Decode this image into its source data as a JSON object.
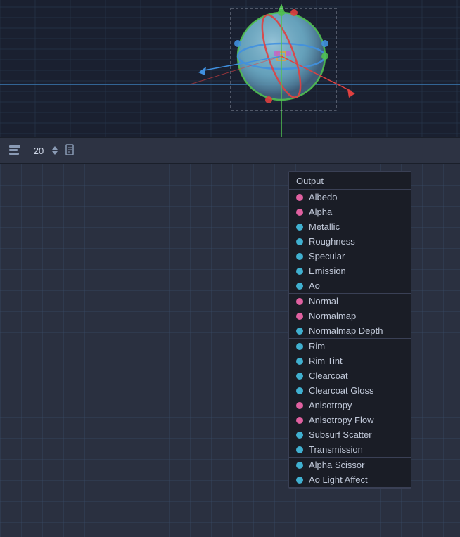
{
  "toolbar": {
    "number": "20",
    "doc_icon": "📄"
  },
  "dropdown": {
    "header": "Output",
    "sections": [
      {
        "items": [
          {
            "label": "Albedo",
            "dot": "pink",
            "id": "albedo"
          },
          {
            "label": "Alpha",
            "dot": "pink",
            "id": "alpha"
          },
          {
            "label": "Metallic",
            "dot": "cyan",
            "id": "metallic"
          },
          {
            "label": "Roughness",
            "dot": "cyan",
            "id": "roughness"
          },
          {
            "label": "Specular",
            "dot": "cyan",
            "id": "specular"
          },
          {
            "label": "Emission",
            "dot": "cyan",
            "id": "emission"
          },
          {
            "label": "Ao",
            "dot": "cyan",
            "id": "ao"
          }
        ]
      },
      {
        "items": [
          {
            "label": "Normal",
            "dot": "pink",
            "id": "normal"
          },
          {
            "label": "Normalmap",
            "dot": "pink",
            "id": "normalmap"
          },
          {
            "label": "Normalmap Depth",
            "dot": "cyan",
            "id": "normalmap-depth"
          }
        ]
      },
      {
        "items": [
          {
            "label": "Rim",
            "dot": "cyan",
            "id": "rim"
          },
          {
            "label": "Rim Tint",
            "dot": "cyan",
            "id": "rim-tint"
          },
          {
            "label": "Clearcoat",
            "dot": "cyan",
            "id": "clearcoat"
          },
          {
            "label": "Clearcoat Gloss",
            "dot": "cyan",
            "id": "clearcoat-gloss"
          },
          {
            "label": "Anisotropy",
            "dot": "pink",
            "id": "anisotropy"
          },
          {
            "label": "Anisotropy Flow",
            "dot": "pink",
            "id": "anisotropy-flow"
          },
          {
            "label": "Subsurf Scatter",
            "dot": "cyan",
            "id": "subsurf-scatter"
          },
          {
            "label": "Transmission",
            "dot": "cyan",
            "id": "transmission"
          }
        ]
      },
      {
        "items": [
          {
            "label": "Alpha Scissor",
            "dot": "cyan",
            "id": "alpha-scissor"
          },
          {
            "label": "Ao Light Affect",
            "dot": "cyan",
            "id": "ao-light-affect"
          }
        ]
      }
    ]
  }
}
